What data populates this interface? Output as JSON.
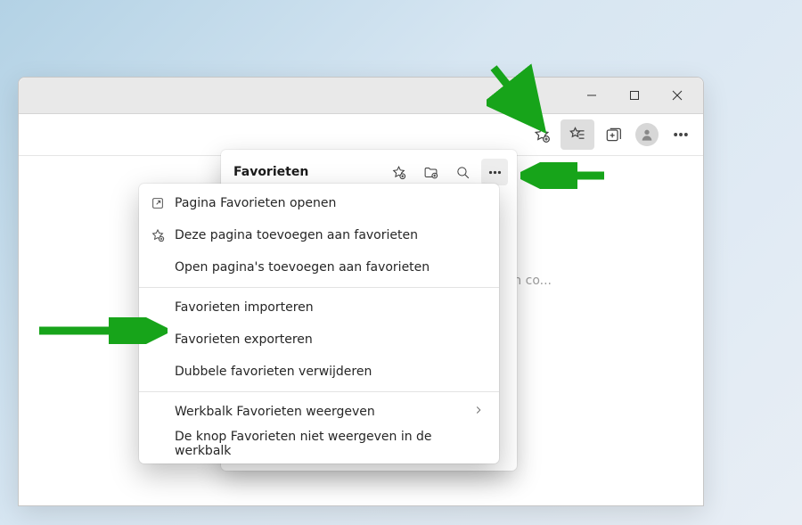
{
  "toolbar": {
    "favorites_button_hint": "Favorieten"
  },
  "background": {
    "truncated_text": "n co..."
  },
  "favorites_popover": {
    "title": "Favorieten"
  },
  "menu": {
    "open_favorites_page": "Pagina Favorieten openen",
    "add_page_to_favorites": "Deze pagina toevoegen aan favorieten",
    "add_open_pages_to_favorites": "Open pagina's toevoegen aan favorieten",
    "import_favorites": "Favorieten importeren",
    "export_favorites": "Favorieten exporteren",
    "remove_duplicates": "Dubbele favorieten verwijderen",
    "show_favorites_toolbar": "Werkbalk Favorieten weergeven",
    "hide_favorites_button": "De knop Favorieten niet weergeven in de werkbalk"
  },
  "colors": {
    "annotation_arrow": "#17a41a"
  }
}
